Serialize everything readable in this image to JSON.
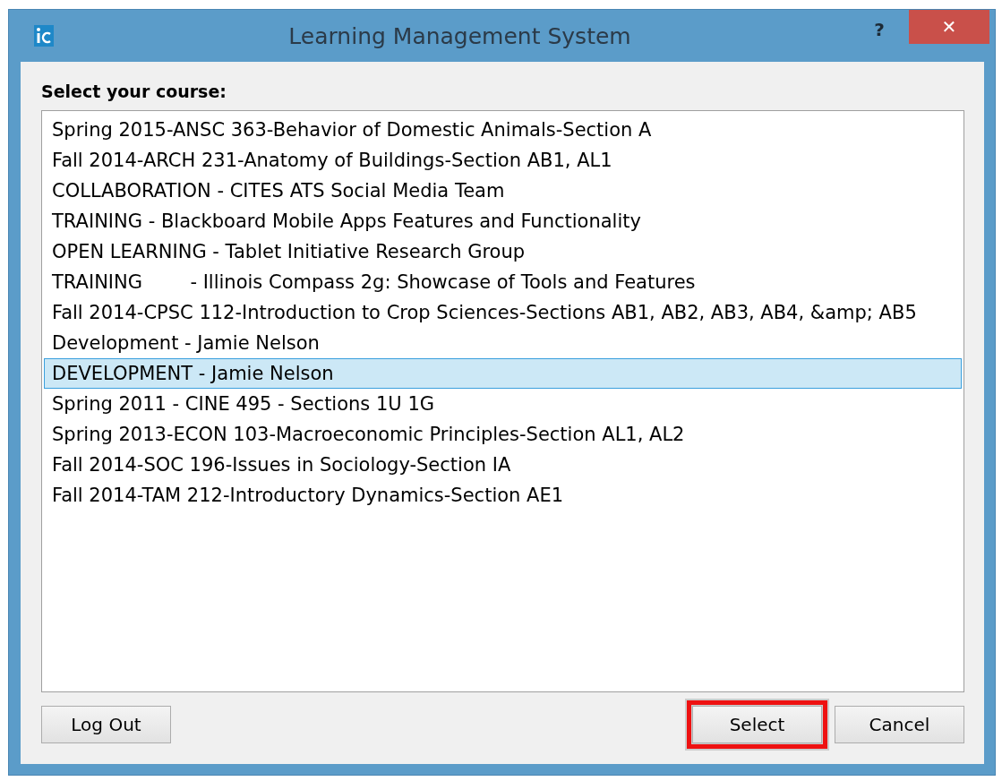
{
  "window": {
    "title": "Learning Management System",
    "help": "?",
    "close": "✕"
  },
  "prompt": "Select your course:",
  "courses": [
    {
      "label": "Spring 2015-ANSC 363-Behavior of Domestic Animals-Section A",
      "selected": false
    },
    {
      "label": "Fall 2014-ARCH 231-Anatomy of Buildings-Section AB1, AL1",
      "selected": false
    },
    {
      "label": "COLLABORATION - CITES ATS Social Media Team",
      "selected": false
    },
    {
      "label": "TRAINING - Blackboard Mobile Apps Features and Functionality",
      "selected": false
    },
    {
      "label": "OPEN LEARNING - Tablet Initiative Research Group",
      "selected": false
    },
    {
      "label": "TRAINING        - Illinois Compass 2g: Showcase of Tools and Features",
      "selected": false
    },
    {
      "label": "Fall 2014-CPSC 112-Introduction to Crop Sciences-Sections AB1, AB2, AB3, AB4, &amp; AB5",
      "selected": false
    },
    {
      "label": "Development - Jamie Nelson",
      "selected": false
    },
    {
      "label": "DEVELOPMENT - Jamie Nelson",
      "selected": true
    },
    {
      "label": "Spring 2011 - CINE 495 - Sections 1U 1G",
      "selected": false
    },
    {
      "label": "Spring 2013-ECON 103-Macroeconomic Principles-Section AL1, AL2",
      "selected": false
    },
    {
      "label": "Fall 2014-SOC 196-Issues in Sociology-Section IA",
      "selected": false
    },
    {
      "label": "Fall 2014-TAM 212-Introductory Dynamics-Section AE1",
      "selected": false
    }
  ],
  "buttons": [
    {
      "label": "Log Out",
      "highlighted": false
    },
    {
      "label": "Select",
      "highlighted": true
    },
    {
      "label": "Cancel",
      "highlighted": false
    }
  ]
}
